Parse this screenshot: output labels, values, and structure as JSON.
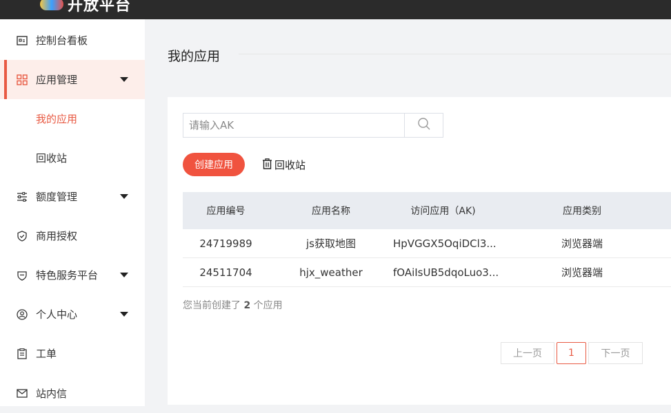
{
  "header": {
    "logo_text": "开放平台"
  },
  "sidebar": {
    "items": [
      {
        "label": "控制台看板",
        "icon": "id-card-icon"
      },
      {
        "label": "应用管理",
        "icon": "grid-icon",
        "expanded": true
      },
      {
        "label": "我的应用",
        "sub": true,
        "current": true
      },
      {
        "label": "回收站",
        "sub": true
      },
      {
        "label": "额度管理",
        "icon": "sliders-icon",
        "expandable": true
      },
      {
        "label": "商用授权",
        "icon": "shield-check-icon"
      },
      {
        "label": "特色服务平台",
        "icon": "heart-shield-icon",
        "expandable": true
      },
      {
        "label": "个人中心",
        "icon": "user-circle-icon",
        "expandable": true
      },
      {
        "label": "工单",
        "icon": "clipboard-icon"
      },
      {
        "label": "站内信",
        "icon": "mail-icon"
      }
    ]
  },
  "main": {
    "title": "我的应用",
    "search": {
      "placeholder": "请输入AK",
      "value": ""
    },
    "create_button": "创建应用",
    "recycle_link": "回收站",
    "table": {
      "headers": [
        "应用编号",
        "应用名称",
        "访问应用（AK)",
        "应用类别"
      ],
      "rows": [
        [
          "24719989",
          "js获取地图",
          "HpVGGX5OqiDCl3...",
          "浏览器端"
        ],
        [
          "24511704",
          "hjx_weather",
          "fOAiIsUB5dqoLuo3...",
          "浏览器端"
        ]
      ]
    },
    "summary": {
      "prefix": "您当前创建了 ",
      "count": "2",
      "suffix": " 个应用"
    },
    "pagination": {
      "prev": "上一页",
      "current": "1",
      "next": "下一页"
    }
  },
  "colors": {
    "accent": "#f0533f",
    "active_bg": "#fdeeea",
    "topbar": "#2b2b2b"
  }
}
